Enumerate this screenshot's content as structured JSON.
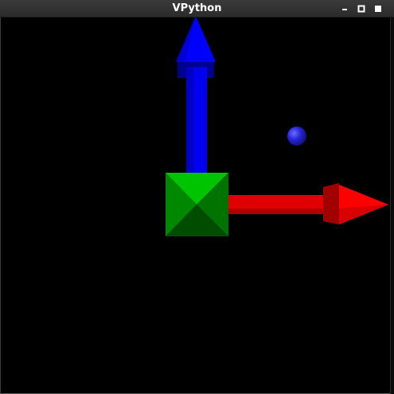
{
  "window": {
    "title": "VPython"
  },
  "titlebar_icons": {
    "minimize": "minimize-icon",
    "maximize": "maximize-icon",
    "close": "close-icon"
  },
  "scene": {
    "background": "#000000",
    "objects": [
      {
        "kind": "arrow",
        "direction": "up",
        "color": "#0000ff"
      },
      {
        "kind": "arrow",
        "direction": "right",
        "color": "#ff0000"
      },
      {
        "kind": "box",
        "color": "#00cc00"
      },
      {
        "kind": "sphere",
        "color": "#2020cc"
      }
    ]
  }
}
